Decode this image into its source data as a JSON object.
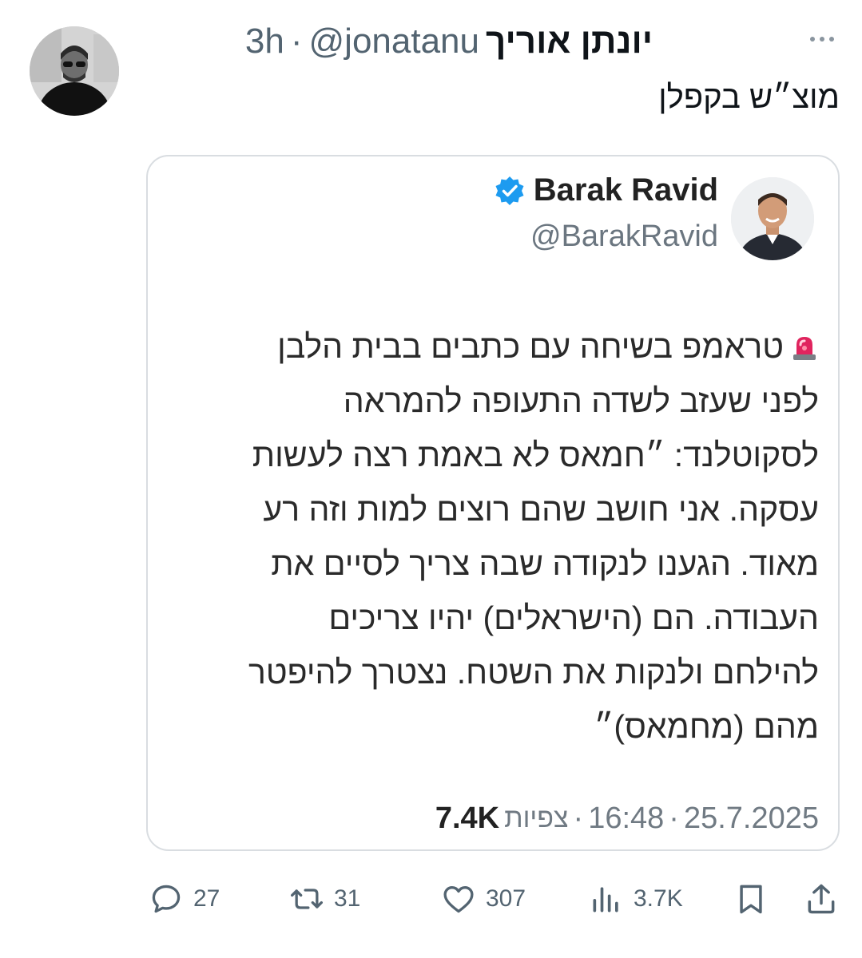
{
  "post": {
    "display_name": "יונתן אוריך",
    "handle": "@jonatanu",
    "separator": "·",
    "time": "3h",
    "text": "מוצ״ש בקפלן"
  },
  "quote": {
    "name": "Barak Ravid",
    "handle": "@BarakRavid",
    "lines": [
      "טראמפ בשיחה עם כתבים בבית הלבן",
      "לפני שעזב לשדה התעופה להמראה",
      "לסקוטלנד: ״חמאס לא באמת רצה לעשות",
      "עסקה. אני חושב שהם רוצים למות וזה רע",
      "מאוד. הגענו לנקודה שבה צריך לסיים את",
      "העבודה. הם (הישראלים) יהיו צריכים",
      "להילחם ולנקות את השטח. נצטרך להיפטר",
      "מהם (מחמאס)״"
    ],
    "date": "25.7.2025",
    "time": "16:48",
    "views_label": "צפיות",
    "views": "7.4K",
    "sep": "·"
  },
  "actions": {
    "replies": "27",
    "reposts": "31",
    "likes": "307",
    "views": "3.7K"
  },
  "icons": {
    "more": "more-horizontal-icon",
    "verified": "verified-badge-icon",
    "siren": "rotating-light-emoji",
    "reply": "reply-icon",
    "repost": "repost-icon",
    "like": "heart-icon",
    "views": "analytics-icon",
    "bookmark": "bookmark-icon",
    "share": "share-icon"
  },
  "colors": {
    "verified": "#1d9bf0",
    "secondary_text": "#536471",
    "card_border": "#d9dde1",
    "siren": "#e0245e"
  }
}
